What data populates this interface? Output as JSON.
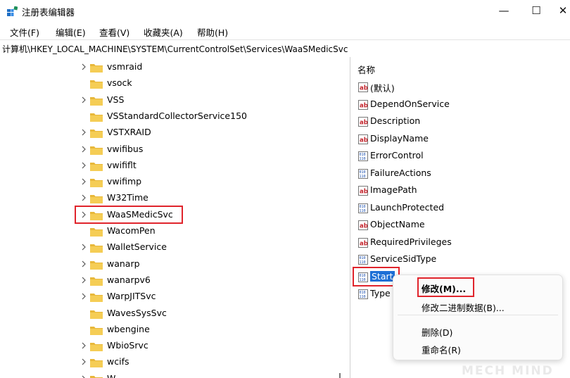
{
  "window": {
    "title": "注册表编辑器",
    "minimize": "—",
    "maximize": "☐",
    "close": "✕"
  },
  "menu": [
    "文件(F)",
    "编辑(E)",
    "查看(V)",
    "收藏夹(A)",
    "帮助(H)"
  ],
  "address": "计算机\\HKEY_LOCAL_MACHINE\\SYSTEM\\CurrentControlSet\\Services\\WaaSMedicSvc",
  "tree": [
    {
      "label": "vsmraid",
      "expandable": true
    },
    {
      "label": "vsock",
      "expandable": false
    },
    {
      "label": "VSS",
      "expandable": true
    },
    {
      "label": "VSStandardCollectorService150",
      "expandable": false
    },
    {
      "label": "VSTXRAID",
      "expandable": true
    },
    {
      "label": "vwifibus",
      "expandable": true
    },
    {
      "label": "vwififlt",
      "expandable": true
    },
    {
      "label": "vwifimp",
      "expandable": true
    },
    {
      "label": "W32Time",
      "expandable": true
    },
    {
      "label": "WaaSMedicSvc",
      "expandable": true,
      "highlighted": true
    },
    {
      "label": "WacomPen",
      "expandable": false
    },
    {
      "label": "WalletService",
      "expandable": true
    },
    {
      "label": "wanarp",
      "expandable": true
    },
    {
      "label": "wanarpv6",
      "expandable": true
    },
    {
      "label": "WarpJITSvc",
      "expandable": true
    },
    {
      "label": "WavesSysSvc",
      "expandable": false
    },
    {
      "label": "wbengine",
      "expandable": false
    },
    {
      "label": "WbioSrvc",
      "expandable": true
    },
    {
      "label": "wcifs",
      "expandable": true
    },
    {
      "label": "W...",
      "expandable": true
    }
  ],
  "values_header": "名称",
  "values": [
    {
      "name": "(默认)",
      "type": "string-icon"
    },
    {
      "name": "DependOnService",
      "type": "string-icon"
    },
    {
      "name": "Description",
      "type": "string-icon"
    },
    {
      "name": "DisplayName",
      "type": "string-icon"
    },
    {
      "name": "ErrorControl",
      "type": "binary-icon"
    },
    {
      "name": "FailureActions",
      "type": "binary-icon"
    },
    {
      "name": "ImagePath",
      "type": "string-icon"
    },
    {
      "name": "LaunchProtected",
      "type": "binary-icon"
    },
    {
      "name": "ObjectName",
      "type": "string-icon"
    },
    {
      "name": "RequiredPrivileges",
      "type": "string-icon"
    },
    {
      "name": "ServiceSidType",
      "type": "binary-icon"
    },
    {
      "name": "Start",
      "type": "binary-icon",
      "selected": true
    },
    {
      "name": "Type",
      "type": "binary-icon"
    }
  ],
  "context_menu": {
    "modify": "修改(M)...",
    "modify_binary": "修改二进制数据(B)...",
    "delete": "删除(D)",
    "rename": "重命名(R)"
  },
  "watermark": "MECH MIND",
  "colors": {
    "highlight_box": "#e0242c",
    "selection": "#1d6fd6",
    "folder": "#e8b83a"
  }
}
